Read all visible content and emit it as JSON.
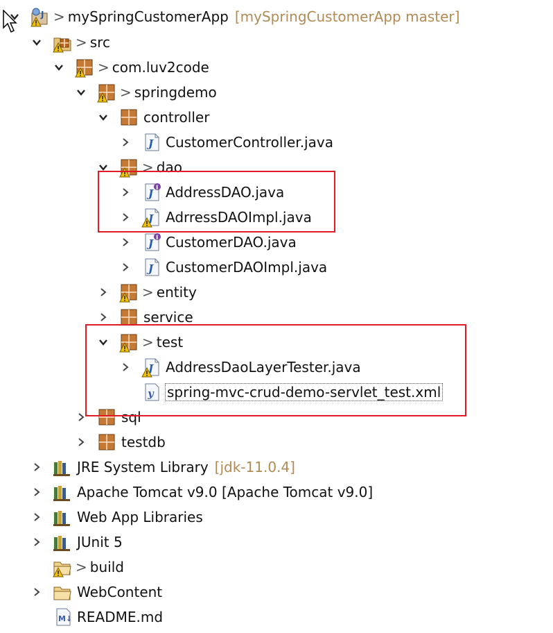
{
  "colors": {
    "highlight": "#e01b24",
    "decoration": "#b28a54",
    "package": "#b5651d",
    "warning": "#f2c200"
  },
  "tree": [
    {
      "label": "mySpringCustomerApp",
      "deco": "[mySpringCustomerApp master]",
      "dirty": true,
      "icon": "java-project-icon",
      "depth": 0,
      "expanded": true
    },
    {
      "label": "src",
      "dirty": true,
      "icon": "source-folder-icon",
      "depth": 1,
      "expanded": true
    },
    {
      "label": "com.luv2code",
      "dirty": true,
      "icon": "package-icon",
      "depth": 2,
      "expanded": true
    },
    {
      "label": "springdemo",
      "dirty": true,
      "icon": "package-icon",
      "depth": 3,
      "expanded": true
    },
    {
      "label": "controller",
      "dirty": false,
      "icon": "package-icon",
      "depth": 4,
      "expanded": true
    },
    {
      "label": "CustomerController.java",
      "dirty": false,
      "icon": "java-file-icon",
      "depth": 5,
      "expanded": false
    },
    {
      "label": "dao",
      "dirty": true,
      "icon": "package-icon",
      "depth": 4,
      "expanded": true
    },
    {
      "label": "AddressDAO.java",
      "dirty": false,
      "icon": "java-interface-file-icon",
      "depth": 5,
      "expanded": false
    },
    {
      "label": "AdrressDAOImpl.java",
      "dirty": false,
      "icon": "java-file-icon",
      "depth": 5,
      "expanded": false
    },
    {
      "label": "CustomerDAO.java",
      "dirty": false,
      "icon": "java-interface-file-icon",
      "depth": 5,
      "expanded": false
    },
    {
      "label": "CustomerDAOImpl.java",
      "dirty": false,
      "icon": "java-file-icon",
      "depth": 5,
      "expanded": false
    },
    {
      "label": "entity",
      "dirty": true,
      "icon": "package-icon",
      "depth": 4,
      "expanded": false
    },
    {
      "label": "service",
      "dirty": false,
      "icon": "package-icon",
      "depth": 4,
      "expanded": false
    },
    {
      "label": "test",
      "dirty": true,
      "icon": "package-icon",
      "depth": 4,
      "expanded": true
    },
    {
      "label": "AddressDaoLayerTester.java",
      "dirty": false,
      "icon": "java-file-icon",
      "depth": 5,
      "expanded": false
    },
    {
      "label": "spring-mvc-crud-demo-servlet_test.xml",
      "dirty": false,
      "icon": "xml-file-icon",
      "depth": 5,
      "leaf": true
    },
    {
      "label": "sql",
      "dirty": false,
      "icon": "package-icon",
      "depth": 3,
      "expanded": false
    },
    {
      "label": "testdb",
      "dirty": false,
      "icon": "package-icon",
      "depth": 3,
      "expanded": false
    },
    {
      "label": "JRE System Library",
      "deco": "[jdk-11.0.4]",
      "dirty": false,
      "icon": "library-icon",
      "depth": 1,
      "expanded": false
    },
    {
      "label": "Apache Tomcat v9.0 [Apache Tomcat v9.0]",
      "dirty": false,
      "icon": "library-icon",
      "depth": 1,
      "expanded": false
    },
    {
      "label": "Web App Libraries",
      "dirty": false,
      "icon": "library-icon",
      "depth": 1,
      "expanded": false
    },
    {
      "label": "JUnit 5",
      "dirty": false,
      "icon": "library-icon",
      "depth": 1,
      "expanded": false
    },
    {
      "label": "build",
      "dirty": true,
      "icon": "folder-icon",
      "depth": 1,
      "leaf": true
    },
    {
      "label": "WebContent",
      "dirty": false,
      "icon": "folder-icon",
      "depth": 1,
      "expanded": false
    },
    {
      "label": "README.md",
      "dirty": false,
      "icon": "markdown-file-icon",
      "depth": 1,
      "leaf": true
    }
  ]
}
